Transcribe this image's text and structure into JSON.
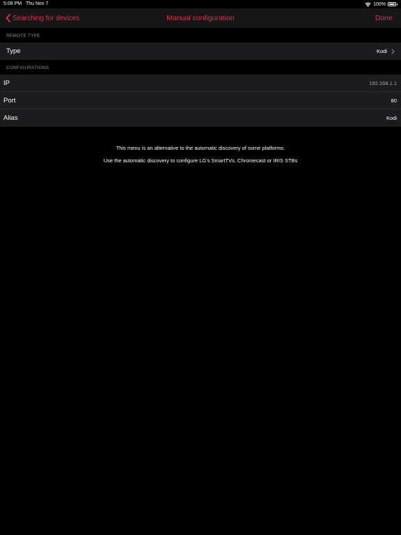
{
  "status_bar": {
    "time": "5:08 PM",
    "date": "Thu Nov 7",
    "battery": "100%",
    "icons": [
      "wifi-icon",
      "battery-icon"
    ]
  },
  "nav": {
    "back_label": "Searching for devices",
    "title": "Manual configuration",
    "done_label": "Done",
    "accent_color": "#e32d4f"
  },
  "remote_type": {
    "header": "REMOTE TYPE",
    "type_label": "Type",
    "type_value": "Kodi"
  },
  "configurations": {
    "header": "CONFIGURATIONS",
    "rows": [
      {
        "label": "IP",
        "value": "192.168.1.1"
      },
      {
        "label": "Port",
        "value": "80"
      },
      {
        "label": "Alias",
        "value": "Kodi"
      }
    ]
  },
  "notes": {
    "line1": "This menu is an alternative to the automatic discovery of some platforms.",
    "line2": "Use the automatic discovery to configure LG's SmartTVs, Chromecast or IRIS STBs"
  }
}
